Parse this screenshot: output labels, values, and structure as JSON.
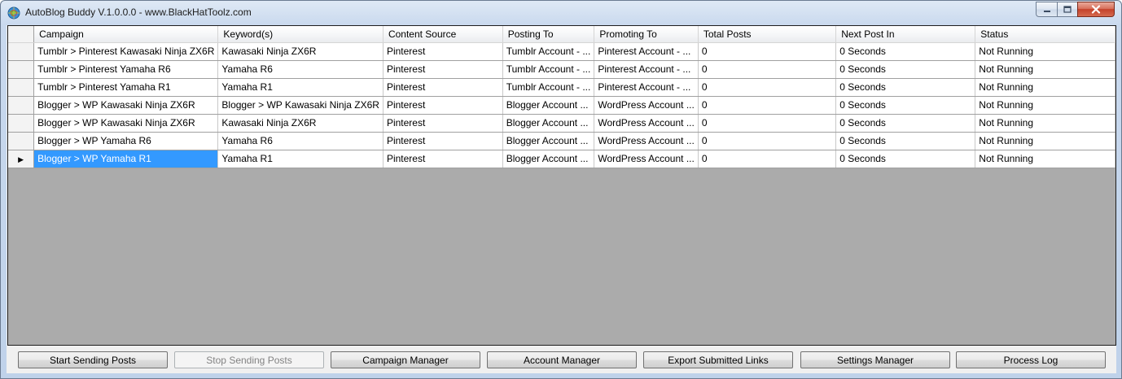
{
  "window": {
    "title": "AutoBlog Buddy V.1.0.0.0 - www.BlackHatToolz.com",
    "controls": {
      "minimize": "minimize-icon",
      "maximize": "maximize-icon",
      "close": "close-icon"
    }
  },
  "grid": {
    "columns": [
      "Campaign",
      "Keyword(s)",
      "Content Source",
      "Posting To",
      "Promoting To",
      "Total Posts",
      "Next Post In",
      "Status"
    ],
    "rows": [
      [
        "Tumblr > Pinterest Kawasaki Ninja ZX6R",
        "Kawasaki Ninja ZX6R",
        "Pinterest",
        "Tumblr Account - ...",
        "Pinterest Account - ...",
        "0",
        "0 Seconds",
        "Not Running"
      ],
      [
        "Tumblr > Pinterest Yamaha R6",
        "Yamaha R6",
        "Pinterest",
        "Tumblr Account - ...",
        "Pinterest Account - ...",
        "0",
        "0 Seconds",
        "Not Running"
      ],
      [
        "Tumblr > Pinterest Yamaha R1",
        "Yamaha R1",
        "Pinterest",
        "Tumblr Account - ...",
        "Pinterest Account - ...",
        "0",
        "0 Seconds",
        "Not Running"
      ],
      [
        "Blogger > WP Kawasaki Ninja ZX6R",
        "Blogger > WP Kawasaki Ninja ZX6R",
        "Pinterest",
        "Blogger Account ...",
        "WordPress Account ...",
        "0",
        "0 Seconds",
        "Not Running"
      ],
      [
        "Blogger > WP Kawasaki Ninja ZX6R",
        "Kawasaki Ninja ZX6R",
        "Pinterest",
        "Blogger Account ...",
        "WordPress Account ...",
        "0",
        "0 Seconds",
        "Not Running"
      ],
      [
        "Blogger > WP Yamaha R6",
        "Yamaha R6",
        "Pinterest",
        "Blogger Account ...",
        "WordPress Account ...",
        "0",
        "0 Seconds",
        "Not Running"
      ],
      [
        "Blogger > WP Yamaha R1",
        "Yamaha R1",
        "Pinterest",
        "Blogger Account ...",
        "WordPress Account ...",
        "0",
        "0 Seconds",
        "Not Running"
      ]
    ],
    "current_row_index": 6,
    "current_row_marker": "▶",
    "selection_color": "#3399ff"
  },
  "buttons": [
    {
      "label": "Start Sending Posts",
      "enabled": true
    },
    {
      "label": "Stop Sending Posts",
      "enabled": false
    },
    {
      "label": "Campaign Manager",
      "enabled": true
    },
    {
      "label": "Account Manager",
      "enabled": true
    },
    {
      "label": "Export Submitted Links",
      "enabled": true
    },
    {
      "label": "Settings Manager",
      "enabled": true
    },
    {
      "label": "Process Log",
      "enabled": true
    }
  ]
}
